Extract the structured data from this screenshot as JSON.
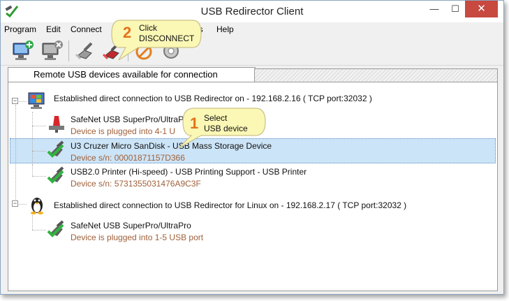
{
  "window": {
    "title": "USB Redirector Client",
    "close_glyph": "✕",
    "min_glyph": "—",
    "max_glyph": "☐"
  },
  "menu": [
    "Program",
    "Edit",
    "Connect",
    "ns",
    "Help"
  ],
  "toolbar": {
    "icons": [
      "add-server-icon",
      "remove-server-icon",
      "connect-device-icon",
      "disconnect-device-icon",
      "share-icon",
      "settings-icon"
    ]
  },
  "tabs": {
    "active": "Remote USB devices available for connection"
  },
  "tree": {
    "connections": [
      {
        "label": "Established direct connection to USB Redirector on - 192.168.2.16 ( TCP port:32032 )",
        "devices": [
          {
            "name": "SafeNet USB SuperPro/UltraP",
            "sub": "Device is plugged into 4-1 U",
            "status": "in-use"
          },
          {
            "name": "U3 Cruzer Micro SanDisk - USB Mass Storage Device",
            "sub": "Device s/n: 00001871157D366",
            "status": "available",
            "selected": true
          },
          {
            "name": "USB2.0 Printer (Hi-speed) - USB Printing Support - USB Printer",
            "sub": "Device s/n: 5731355031476A9C3F",
            "status": "available"
          }
        ]
      },
      {
        "label": "Established direct connection to USB Redirector for Linux on - 192.168.2.17 ( TCP port:32032 )",
        "devices": [
          {
            "name": "SafeNet USB SuperPro/UltraPro",
            "sub": "Device is plugged into 1-5 USB port",
            "status": "available"
          }
        ]
      }
    ]
  },
  "callouts": [
    {
      "number": "2",
      "line1": "Click",
      "line2": "DISCONNECT"
    },
    {
      "number": "1",
      "line1": "Select",
      "line2": "USB device"
    }
  ],
  "colors": {
    "callout_fill": "#fbf7b5",
    "callout_border": "#c9c28a",
    "callout_number": "#e57219",
    "selection": "#cce4f7",
    "sub_text": "#a0603a",
    "close_button": "#c7493f"
  }
}
